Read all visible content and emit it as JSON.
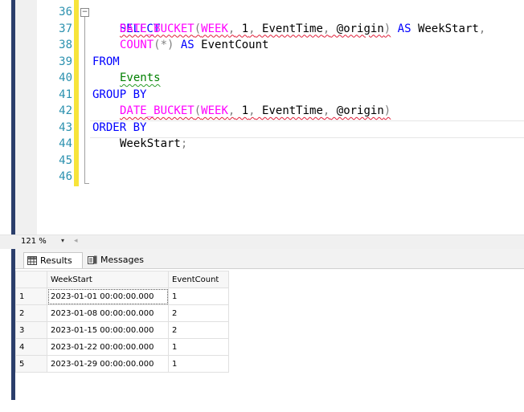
{
  "editor": {
    "lines": [
      {
        "num": "36",
        "code": "SELECT"
      },
      {
        "num": "37",
        "code": "DATE_BUCKET(WEEK, 1, EventTime, @origin) AS WeekStart,"
      },
      {
        "num": "38",
        "code": "COUNT(*) AS EventCount"
      },
      {
        "num": "39",
        "code": "FROM"
      },
      {
        "num": "40",
        "code": "Events"
      },
      {
        "num": "41",
        "code": "GROUP BY"
      },
      {
        "num": "42",
        "code": "DATE_BUCKET(WEEK, 1, EventTime, @origin)"
      },
      {
        "num": "43",
        "code": "ORDER BY"
      },
      {
        "num": "44",
        "code": "WeekStart;"
      },
      {
        "num": "45",
        "code": ""
      },
      {
        "num": "46",
        "code": ""
      }
    ],
    "tokens": {
      "select": "SELECT",
      "date_bucket": "DATE_BUCKET",
      "paren_open": "(",
      "week": "WEEK",
      "comma1": ",",
      "one": " 1",
      "comma2": ",",
      "eventtime": " EventTime",
      "comma3": ",",
      "origin": " @origin",
      "paren_close": ")",
      "as": " AS",
      "weekstart_alias": " WeekStart",
      "comma_end": ",",
      "count": "COUNT",
      "star": "(*)",
      "as2": " AS",
      "eventcount_alias": " EventCount",
      "from": "FROM",
      "events": "Events",
      "group_by": "GROUP BY",
      "order_by": "ORDER BY",
      "weekstart_order": "WeekStart",
      "semicolon": ";"
    },
    "collapse_symbol": "−"
  },
  "zoom": {
    "level": "121 %",
    "dropdown_glyph": "▾",
    "scroll_left_glyph": "◂"
  },
  "results": {
    "tabs": [
      {
        "label": "Results",
        "icon": "grid-icon"
      },
      {
        "label": "Messages",
        "icon": "messages-icon"
      }
    ],
    "columns": [
      "WeekStart",
      "EventCount"
    ],
    "rows": [
      {
        "n": "1",
        "week": "2023-01-01 00:00:00.000",
        "count": "1"
      },
      {
        "n": "2",
        "week": "2023-01-08 00:00:00.000",
        "count": "2"
      },
      {
        "n": "3",
        "week": "2023-01-15 00:00:00.000",
        "count": "2"
      },
      {
        "n": "4",
        "week": "2023-01-22 00:00:00.000",
        "count": "1"
      },
      {
        "n": "5",
        "week": "2023-01-29 00:00:00.000",
        "count": "1"
      }
    ]
  },
  "colors": {
    "keyword": "#0000ff",
    "function": "#ff00ff",
    "operator": "#808080",
    "object": "#008000",
    "line_number": "#2b91af",
    "change_bar": "#f7e43a"
  }
}
